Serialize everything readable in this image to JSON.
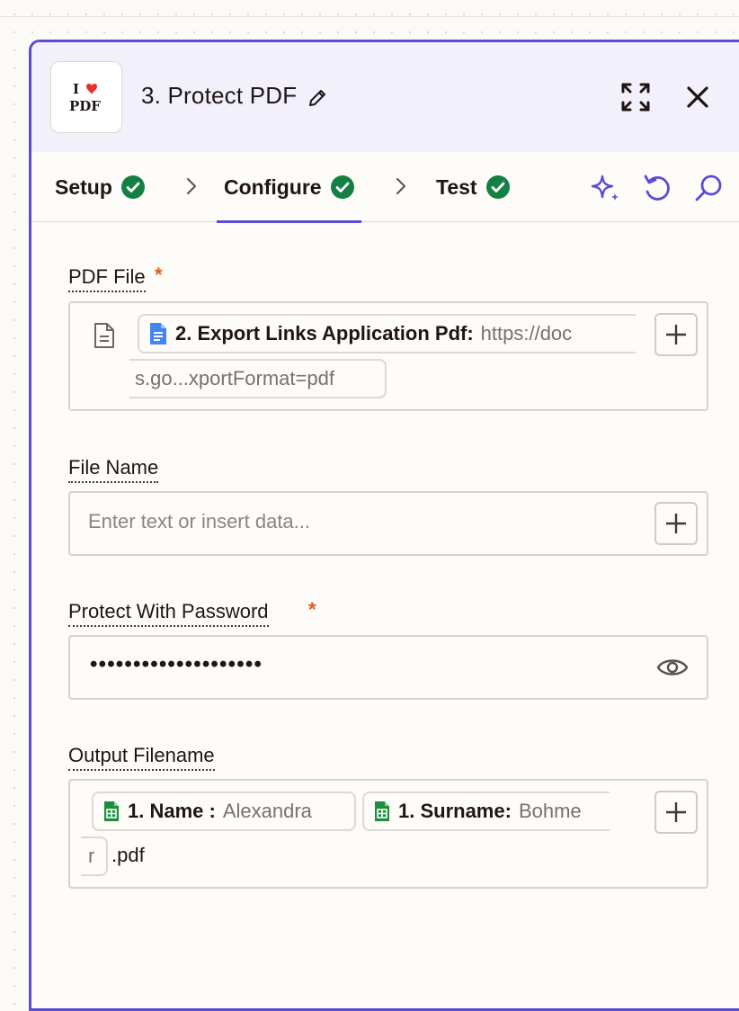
{
  "header": {
    "step_title": "3. Protect PDF",
    "logo_top": "I",
    "logo_bottom": "PDF"
  },
  "tabs": [
    {
      "label": "Setup",
      "complete": true
    },
    {
      "label": "Configure",
      "complete": true,
      "active": true
    },
    {
      "label": "Test",
      "complete": true
    }
  ],
  "fields": {
    "pdf_file": {
      "label": "PDF File",
      "required_mark": "*",
      "pill_key": "2. Export Links Application Pdf:",
      "pill_value": "https://doc",
      "pill_value_cont": "s.go...xportFormat=pdf"
    },
    "file_name": {
      "label": "File Name",
      "placeholder": "Enter text or insert data..."
    },
    "password": {
      "label": "Protect With Password",
      "required_mark": "*",
      "masked_value": "••••••••••••••••••••"
    },
    "output_filename": {
      "label": "Output Filename",
      "pill1_key": "1. Name :",
      "pill1_value": "Alexandra",
      "pill2_key": "1. Surname:",
      "pill2_value": "Bohme",
      "pill2_value_cont": "r",
      "suffix": ".pdf"
    }
  },
  "colors": {
    "accent": "#5b4bd6",
    "success": "#138044",
    "required": "#e2591b",
    "docs_blue": "#4285f4",
    "sheets_green": "#1e8e3e"
  },
  "icons": [
    "edit-icon",
    "expand-icon",
    "close-icon",
    "check-icon",
    "chevron-right-icon",
    "sparkle-icon",
    "undo-icon",
    "search-icon",
    "document-icon",
    "google-docs-icon",
    "google-sheets-icon",
    "plus-icon",
    "eye-icon"
  ]
}
